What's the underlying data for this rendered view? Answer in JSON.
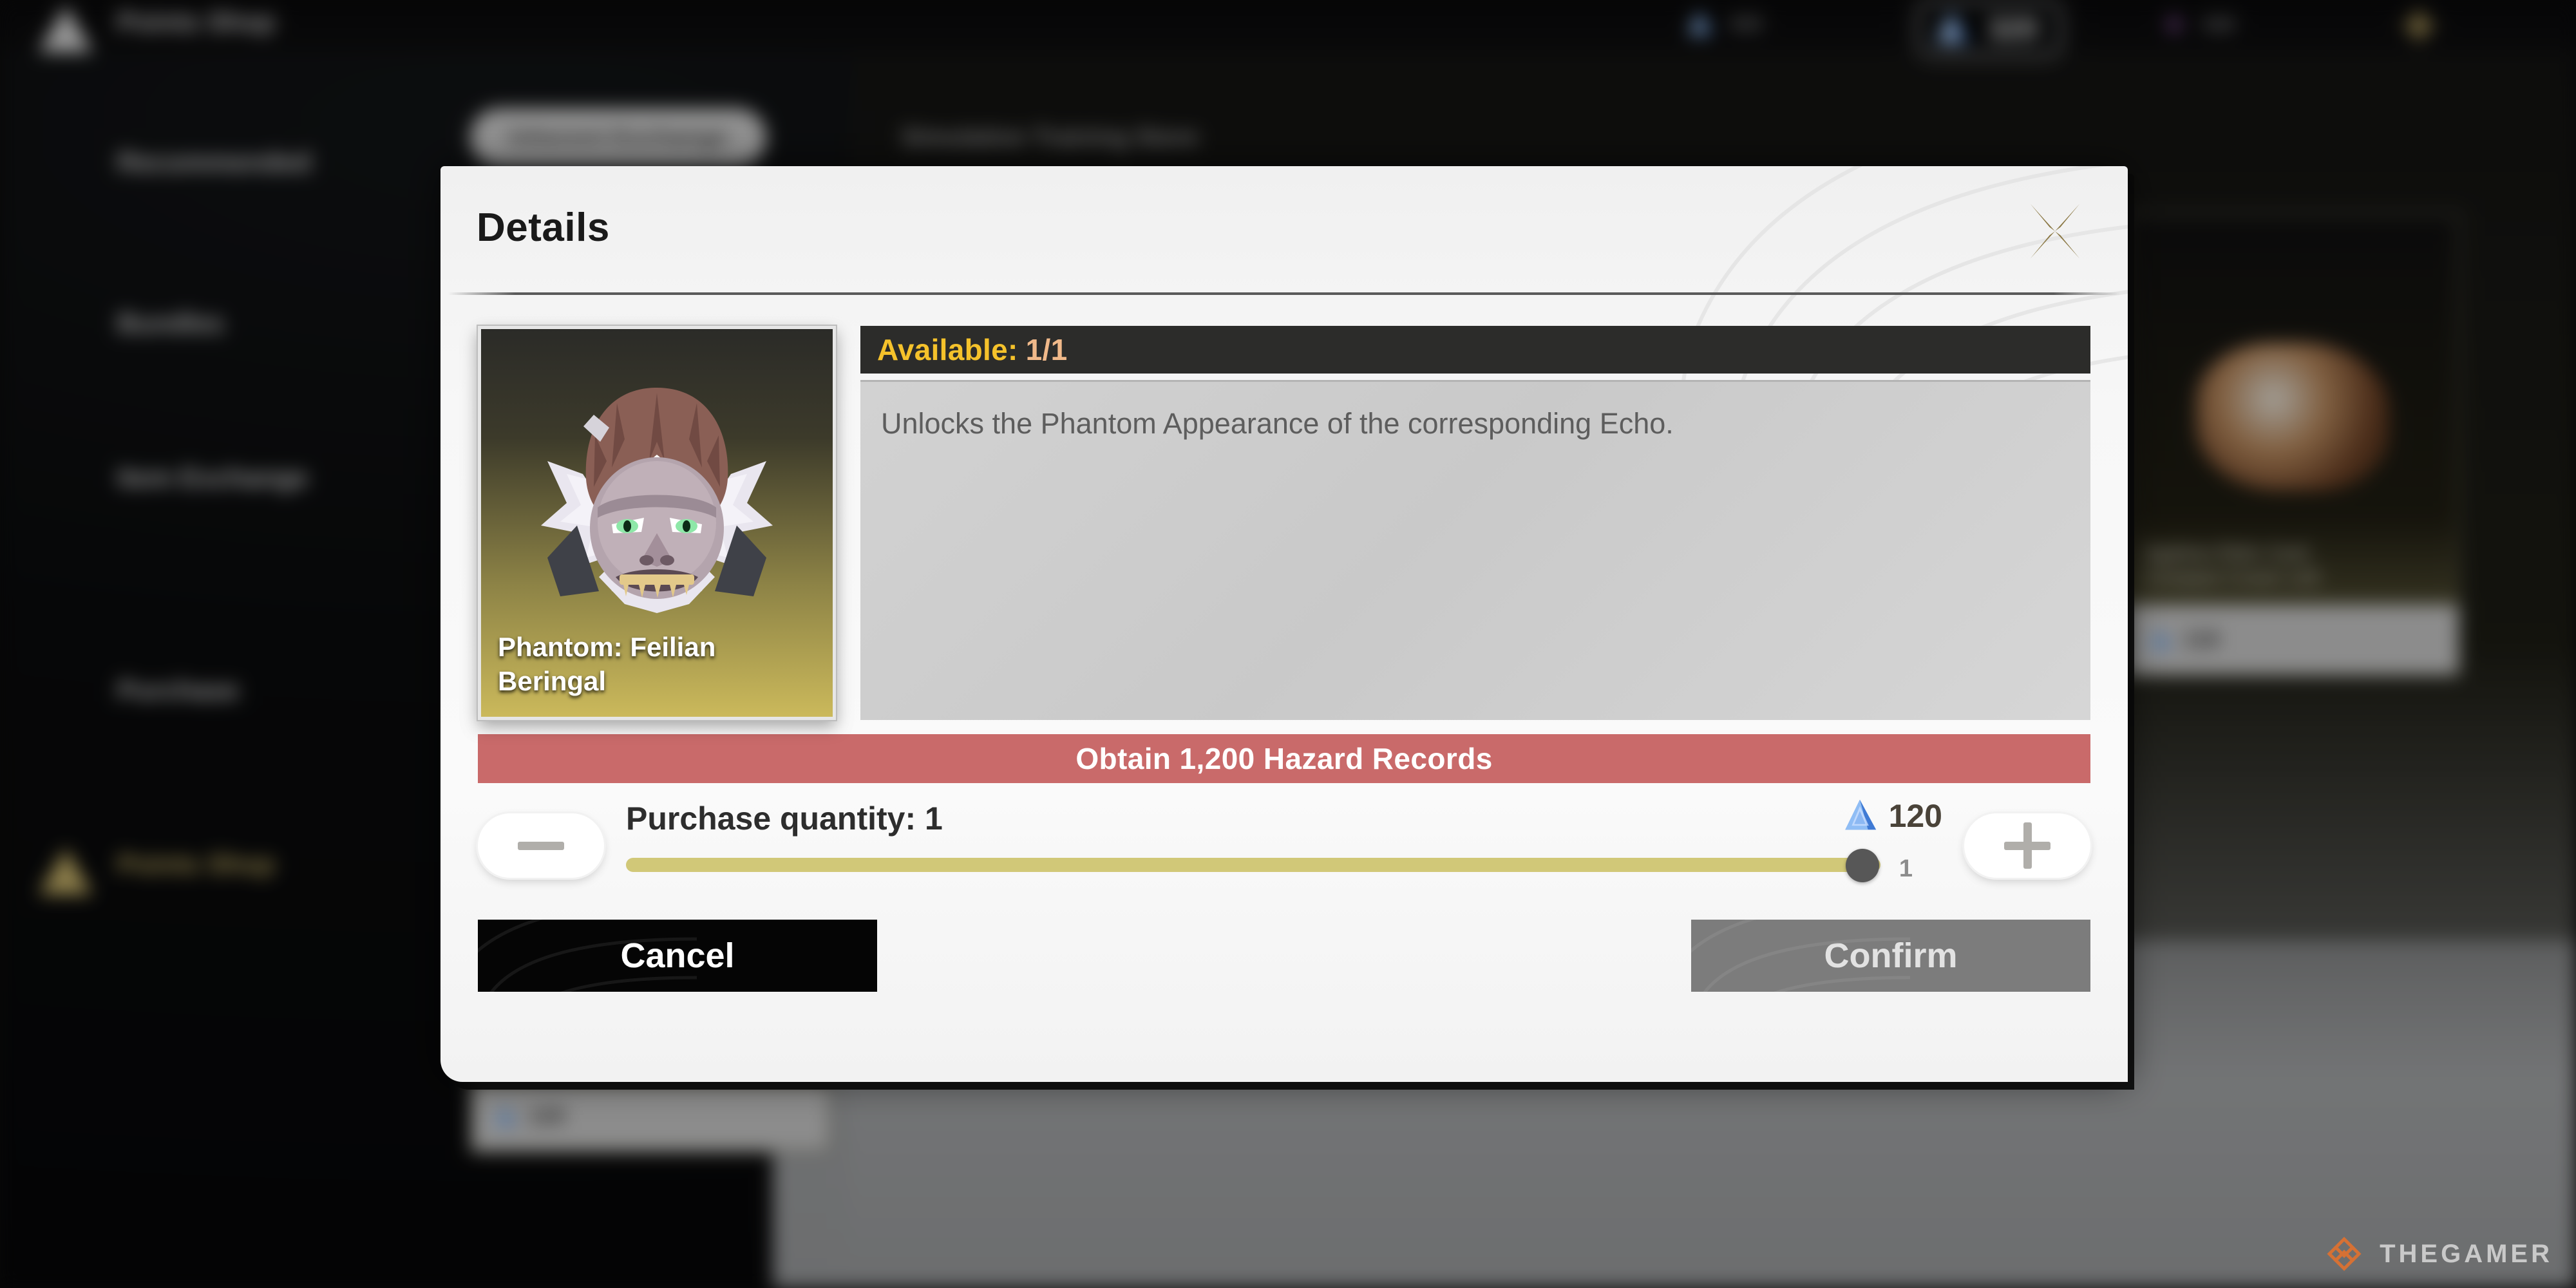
{
  "topbar": {
    "currencies": [
      {
        "icon": "crystal-icon",
        "value": "320",
        "highlighted": true
      }
    ]
  },
  "sidebar": {
    "items": [
      {
        "label": "Points Shop",
        "icon": "triangle-icon",
        "active": false
      },
      {
        "label": "Recommended",
        "icon": "banner-icon",
        "active": false
      },
      {
        "label": "Bundles",
        "icon": "bag-icon",
        "active": false
      },
      {
        "label": "Item Exchange",
        "icon": "diamond-icon",
        "active": false
      },
      {
        "label": "Purchase",
        "icon": "coin-icon",
        "active": false
      },
      {
        "label": "Points Shop",
        "icon": "triangle-icon",
        "active": true
      }
    ]
  },
  "tabs": [
    {
      "label": "Inherent Exchange",
      "selected": true
    },
    {
      "label": "Simulation Training Store",
      "selected": false
    }
  ],
  "background_cards": [
    {
      "title": "Ageless Relic Card\nCompact Crown x18",
      "price": "118"
    },
    {
      "title": "",
      "price": "120"
    }
  ],
  "modal": {
    "title": "Details",
    "close_icon": "close-star-icon",
    "item": {
      "name": "Phantom: Feilian Beringal",
      "artwork": "feilian-beringal-phantom-art"
    },
    "availability": {
      "label": "Available:",
      "value": "1/1"
    },
    "description": "Unlocks the Phantom Appearance of the corresponding Echo.",
    "obtain_banner": "Obtain 1,200 Hazard Records",
    "quantity": {
      "label": "Purchase quantity: 1",
      "decrease_icon": "minus-icon",
      "increase_icon": "plus-icon",
      "price_icon": "crystal-icon",
      "price": "120",
      "slider_value": "1",
      "slider_percent": 100
    },
    "buttons": {
      "cancel": "Cancel",
      "confirm": "Confirm"
    }
  },
  "watermark": {
    "text": "THEGAMER",
    "icon": "thegamer-logo-icon"
  },
  "colors": {
    "accent_gold": "#c9b468",
    "available_label": "#f5c22b",
    "available_value": "#f0b98a",
    "obtain_banner": "#c96a6a",
    "slider_track": "#d1c878",
    "cancel_bg": "#050505",
    "confirm_bg": "#7c7c7c",
    "close_icon": "#8a7743",
    "crystal_blue": "#5b9be8",
    "watermark_orange": "#e8712a"
  }
}
